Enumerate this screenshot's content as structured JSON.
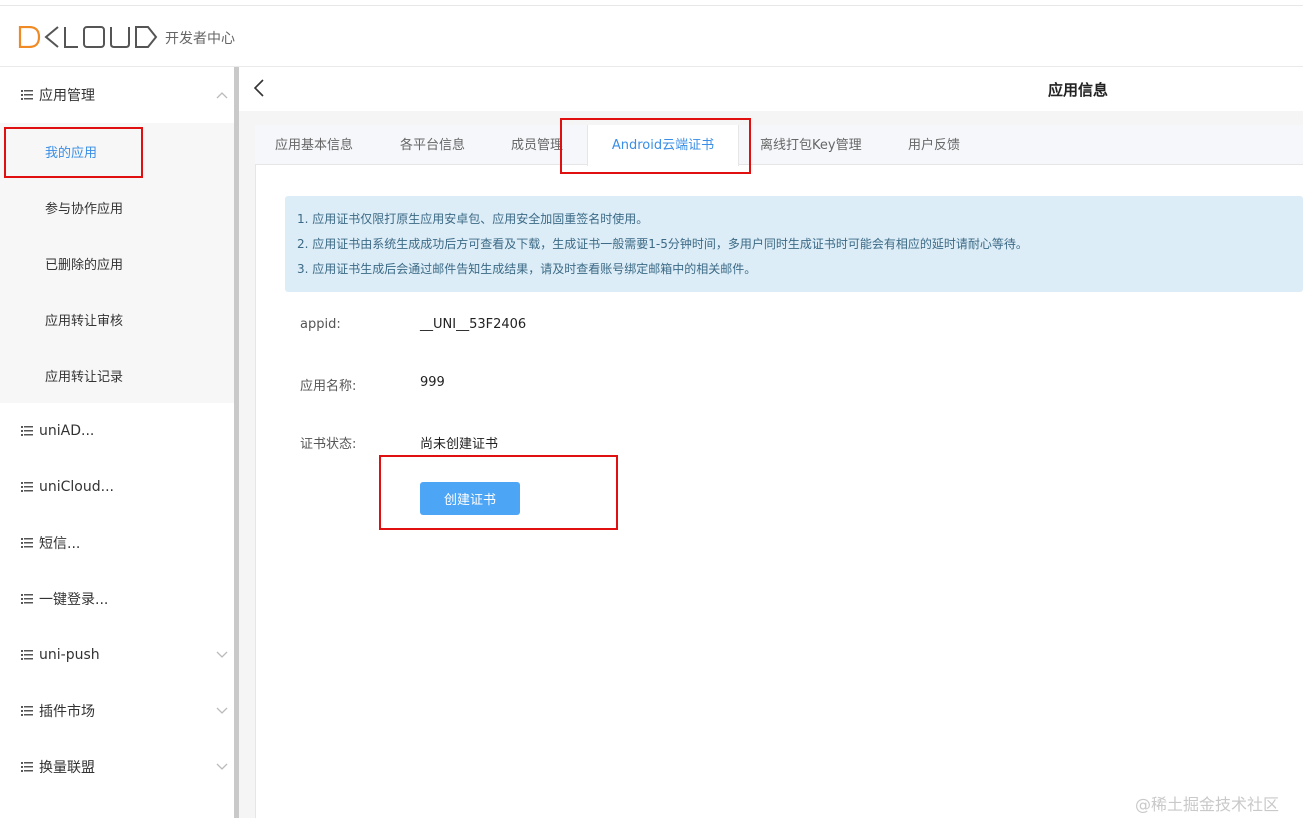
{
  "header": {
    "logo_text": "DCLOUD",
    "subtitle": "开发者中心"
  },
  "sidebar": {
    "groups": [
      {
        "label": "应用管理",
        "chevron": "up"
      },
      {
        "label": "uniAD...",
        "chevron": "none"
      },
      {
        "label": "uniCloud...",
        "chevron": "none"
      },
      {
        "label": "短信...",
        "chevron": "none"
      },
      {
        "label": "一键登录...",
        "chevron": "none"
      },
      {
        "label": "uni-push",
        "chevron": "down"
      },
      {
        "label": "插件市场",
        "chevron": "down"
      },
      {
        "label": "换量联盟",
        "chevron": "down"
      }
    ],
    "subitems": [
      {
        "label": "我的应用",
        "active": true
      },
      {
        "label": "参与协作应用"
      },
      {
        "label": "已删除的应用"
      },
      {
        "label": "应用转让审核"
      },
      {
        "label": "应用转让记录"
      }
    ]
  },
  "page": {
    "title": "应用信息"
  },
  "tabs": [
    {
      "label": "应用基本信息"
    },
    {
      "label": "各平台信息"
    },
    {
      "label": "成员管理"
    },
    {
      "label": "Android云端证书",
      "active": true
    },
    {
      "label": "离线打包Key管理"
    },
    {
      "label": "用户反馈"
    }
  ],
  "notice": {
    "lines": [
      "1. 应用证书仅限打原生应用安卓包、应用安全加固重签名时使用。",
      "2. 应用证书由系统生成成功后方可查看及下载，生成证书一般需要1-5分钟时间，多用户同时生成证书时可能会有相应的延时请耐心等待。",
      "3. 应用证书生成后会通过邮件告知生成结果，请及时查看账号绑定邮箱中的相关邮件。"
    ]
  },
  "fields": {
    "appid_label": "appid:",
    "appid_value": "__UNI__53F2406",
    "name_label": "应用名称:",
    "name_value": "999",
    "status_label": "证书状态:",
    "status_value": "尚未创建证书"
  },
  "actions": {
    "create_label": "创建证书"
  },
  "watermark": "@稀土掘金技术社区",
  "colors": {
    "accent": "#3a8ee6",
    "button": "#4ca5f5",
    "notice_bg": "#dcedf7",
    "highlight_box": "#e01010",
    "logo": "#f08a24"
  }
}
